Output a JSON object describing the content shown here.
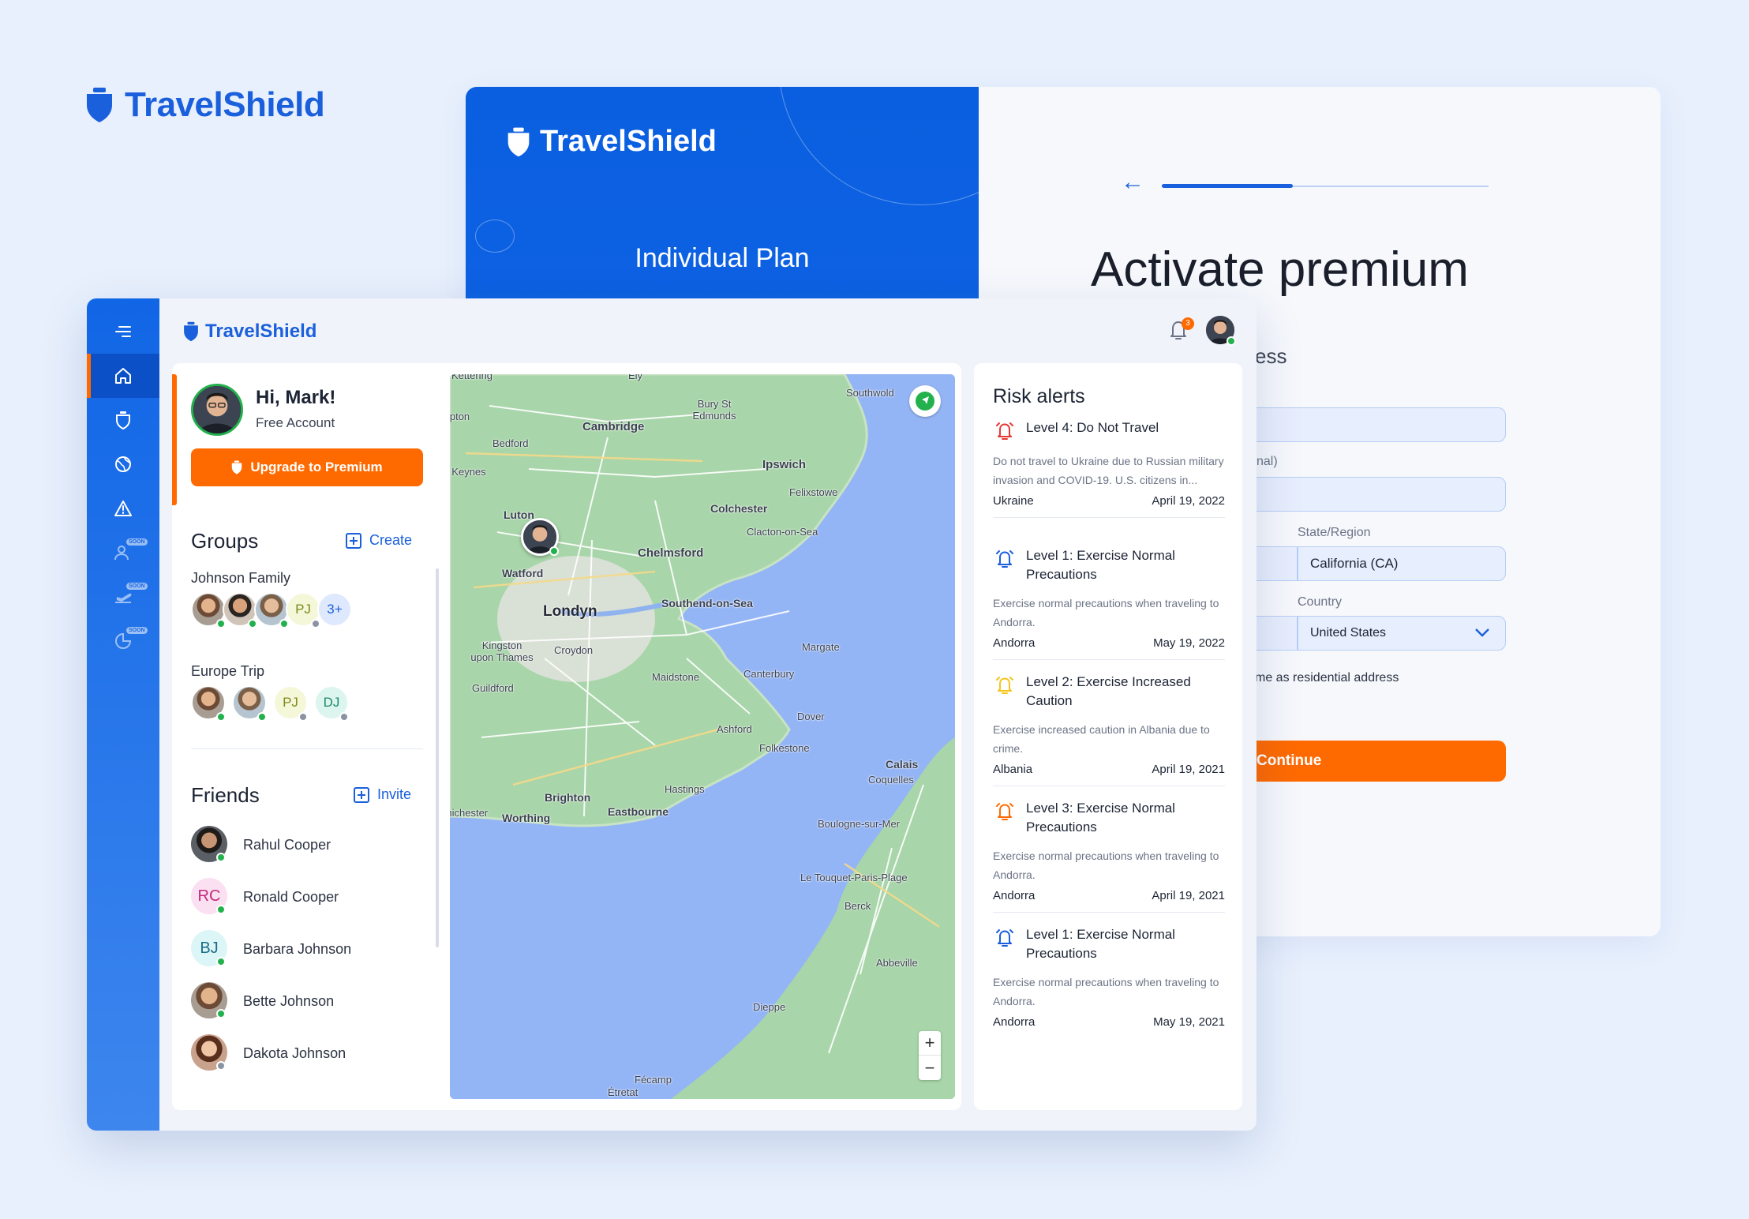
{
  "brand": {
    "name": "TravelShield",
    "color": "#1a5fdc",
    "accent": "#ff6a00"
  },
  "premium": {
    "plan_title": "Individual Plan",
    "heading": "Activate premium",
    "section_partial": "ess",
    "optional_partial": "nal)",
    "state_label": "State/Region",
    "state_value": "California (CA)",
    "country_label": "Country",
    "country_value": "United States",
    "checkbox_partial": "me as residential address",
    "continue_label": "Continue"
  },
  "header": {
    "notification_count": "3"
  },
  "profile": {
    "greeting": "Hi, Mark!",
    "account_type": "Free Account",
    "upgrade_label": "Upgrade to Premium"
  },
  "groups": {
    "title": "Groups",
    "action": "Create",
    "items": [
      {
        "name": "Johnson Family",
        "initials": [
          "PJ"
        ],
        "more": "3+"
      },
      {
        "name": "Europe Trip",
        "initials": [
          "PJ",
          "DJ"
        ]
      }
    ]
  },
  "friends": {
    "title": "Friends",
    "action": "Invite",
    "items": [
      {
        "name": "Rahul Cooper",
        "initials": ""
      },
      {
        "name": "Ronald Cooper",
        "initials": "RC"
      },
      {
        "name": "Barbara Johnson",
        "initials": "BJ"
      },
      {
        "name": "Bette Johnson",
        "initials": ""
      },
      {
        "name": "Dakota Johnson",
        "initials": ""
      }
    ]
  },
  "map": {
    "labels": [
      "Kettering",
      "Ely",
      "Southwold",
      "Northampton",
      "Bury St Edmunds",
      "Cambridge",
      "Bedford",
      "Ipswich",
      "Milton Keynes",
      "Felixstowe",
      "Luton",
      "Colchester",
      "Clacton-on-Sea",
      "Chelmsford",
      "Watford",
      "Londyn",
      "Southend-on-Sea",
      "Kingston upon Thames",
      "Croydon",
      "Margate",
      "Maidstone",
      "Canterbury",
      "Guildford",
      "Dover",
      "Ashford",
      "Folkestone",
      "Calais",
      "Coquelles",
      "Brighton",
      "Hastings",
      "Chichester",
      "Worthing",
      "Eastbourne",
      "Boulogne-sur-Mer",
      "Le Touquet-Paris-Plage",
      "Berck",
      "Abbeville",
      "Dieppe",
      "Fécamp",
      "Étretat"
    ],
    "zoom_in": "+",
    "zoom_out": "−"
  },
  "risk_alerts": {
    "title": "Risk alerts",
    "items": [
      {
        "level": "Level 4: Do Not Travel",
        "desc": "Do not travel to Ukraine due to Russian military invasion and COVID-19. U.S. citizens in...",
        "country": "Ukraine",
        "date": "April 19, 2022",
        "color": "#e53935"
      },
      {
        "level": "Level 1: Exercise Normal Precautions",
        "desc": "Exercise normal precautions when traveling to Andorra.",
        "country": "Andorra",
        "date": "May 19, 2022",
        "color": "#1a5fdc"
      },
      {
        "level": "Level 2: Exercise Increased Caution",
        "desc": "Exercise increased caution in Albania due to crime.",
        "country": "Albania",
        "date": "April 19, 2021",
        "color": "#f5c518"
      },
      {
        "level": "Level 3: Exercise Normal Precautions",
        "desc": "Exercise normal precautions when traveling to Andorra.",
        "country": "Andorra",
        "date": "April 19, 2021",
        "color": "#ff6a00"
      },
      {
        "level": "Level 1: Exercise Normal Precautions",
        "desc": "Exercise normal precautions when traveling to Andorra.",
        "country": "Andorra",
        "date": "May 19, 2021",
        "color": "#1a5fdc"
      }
    ]
  },
  "sidebar": {
    "items": [
      {
        "icon": "menu-icon"
      },
      {
        "icon": "home-icon",
        "active": true
      },
      {
        "icon": "shield-icon"
      },
      {
        "icon": "globe-icon"
      },
      {
        "icon": "warning-icon"
      },
      {
        "icon": "user-plus-icon",
        "badge": "SOON"
      },
      {
        "icon": "plane-icon",
        "badge": "SOON"
      },
      {
        "icon": "chart-icon",
        "badge": "SOON"
      }
    ]
  }
}
